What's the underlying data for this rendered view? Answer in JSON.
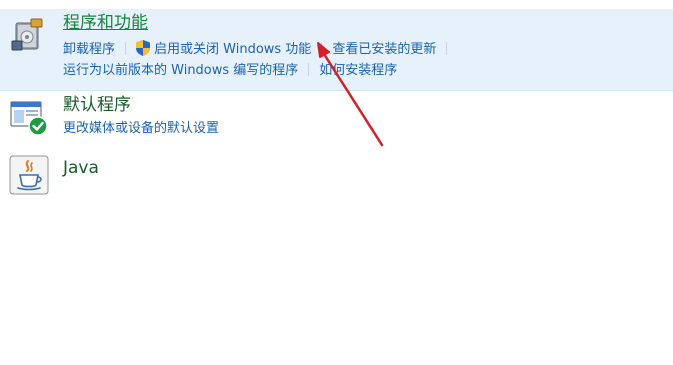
{
  "categories": [
    {
      "title": "程序和功能",
      "icon": "programs-features-icon",
      "links_row1": [
        "卸载程序",
        "启用或关闭 Windows 功能",
        "查看已安装的更新"
      ],
      "links_row2": [
        "运行为以前版本的 Windows 编写的程序",
        "如何安装程序"
      ]
    },
    {
      "title": "默认程序",
      "icon": "default-programs-icon",
      "links_row1": [
        "更改媒体或设备的默认设置"
      ]
    },
    {
      "title": "Java",
      "icon": "java-icon"
    }
  ],
  "colors": {
    "highlight_bg": "#e6f1fb",
    "title_green": "#17863a",
    "link_blue": "#1a63b0",
    "arrow_red": "#d3202a"
  }
}
